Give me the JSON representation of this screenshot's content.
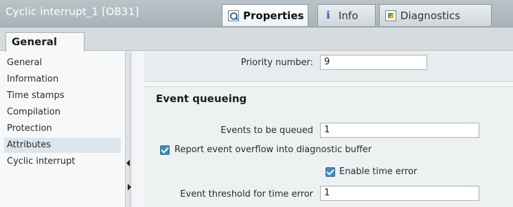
{
  "window": {
    "title": "Cyclic interrupt_1 [OB31]"
  },
  "tabs": [
    {
      "label": "Properties",
      "icon": "properties-icon",
      "active": true
    },
    {
      "label": "Info",
      "icon": "info-icon",
      "active": false
    },
    {
      "label": "Diagnostics",
      "icon": "diagnostics-icon",
      "active": false
    }
  ],
  "subtab": {
    "label": "General"
  },
  "nav": {
    "items": [
      {
        "label": "General"
      },
      {
        "label": "Information"
      },
      {
        "label": "Time stamps"
      },
      {
        "label": "Compilation"
      },
      {
        "label": "Protection"
      },
      {
        "label": "Attributes",
        "selected": true
      },
      {
        "label": "Cyclic interrupt"
      }
    ]
  },
  "priority": {
    "label": "Priority number:",
    "value": "9"
  },
  "event_queueing": {
    "heading": "Event queueing",
    "events_label": "Events to be queued",
    "events_value": "1",
    "report_overflow_label": "Report event overflow into diagnostic buffer",
    "report_overflow_checked": true,
    "enable_time_error_label": "Enable time error",
    "enable_time_error_checked": true,
    "threshold_label": "Event threshold for time error",
    "threshold_value": "1"
  },
  "colors": {
    "checkbox": "#3d8ec2",
    "selected_nav": "#dde5ec"
  }
}
